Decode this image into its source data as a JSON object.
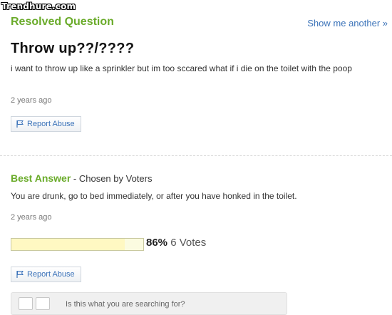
{
  "watermark": "Trendhure.com",
  "question": {
    "status": "Resolved Question",
    "show_another": "Show me another »",
    "title": "Throw up??/????",
    "body": "i want to throw up like a sprinkler but im too sccared what if i die on the toilet with the poop",
    "age": "2 years ago",
    "report": "Report Abuse"
  },
  "answer": {
    "best_label": "Best Answer",
    "chosen_by": " - Chosen by Voters",
    "body": "You are drunk, go to bed immediately, or after you have honked in the toilet.",
    "age": "2 years ago",
    "vote_percent_text": "86%",
    "vote_percent_value": 0.86,
    "votes_text": "6 Votes",
    "report": "Report Abuse"
  },
  "footer": {
    "prompt": "Is this what you are searching for?"
  },
  "colors": {
    "green": "#6aab2a",
    "link_blue": "#3b73b9",
    "bar_fill": "#fff8c2"
  }
}
